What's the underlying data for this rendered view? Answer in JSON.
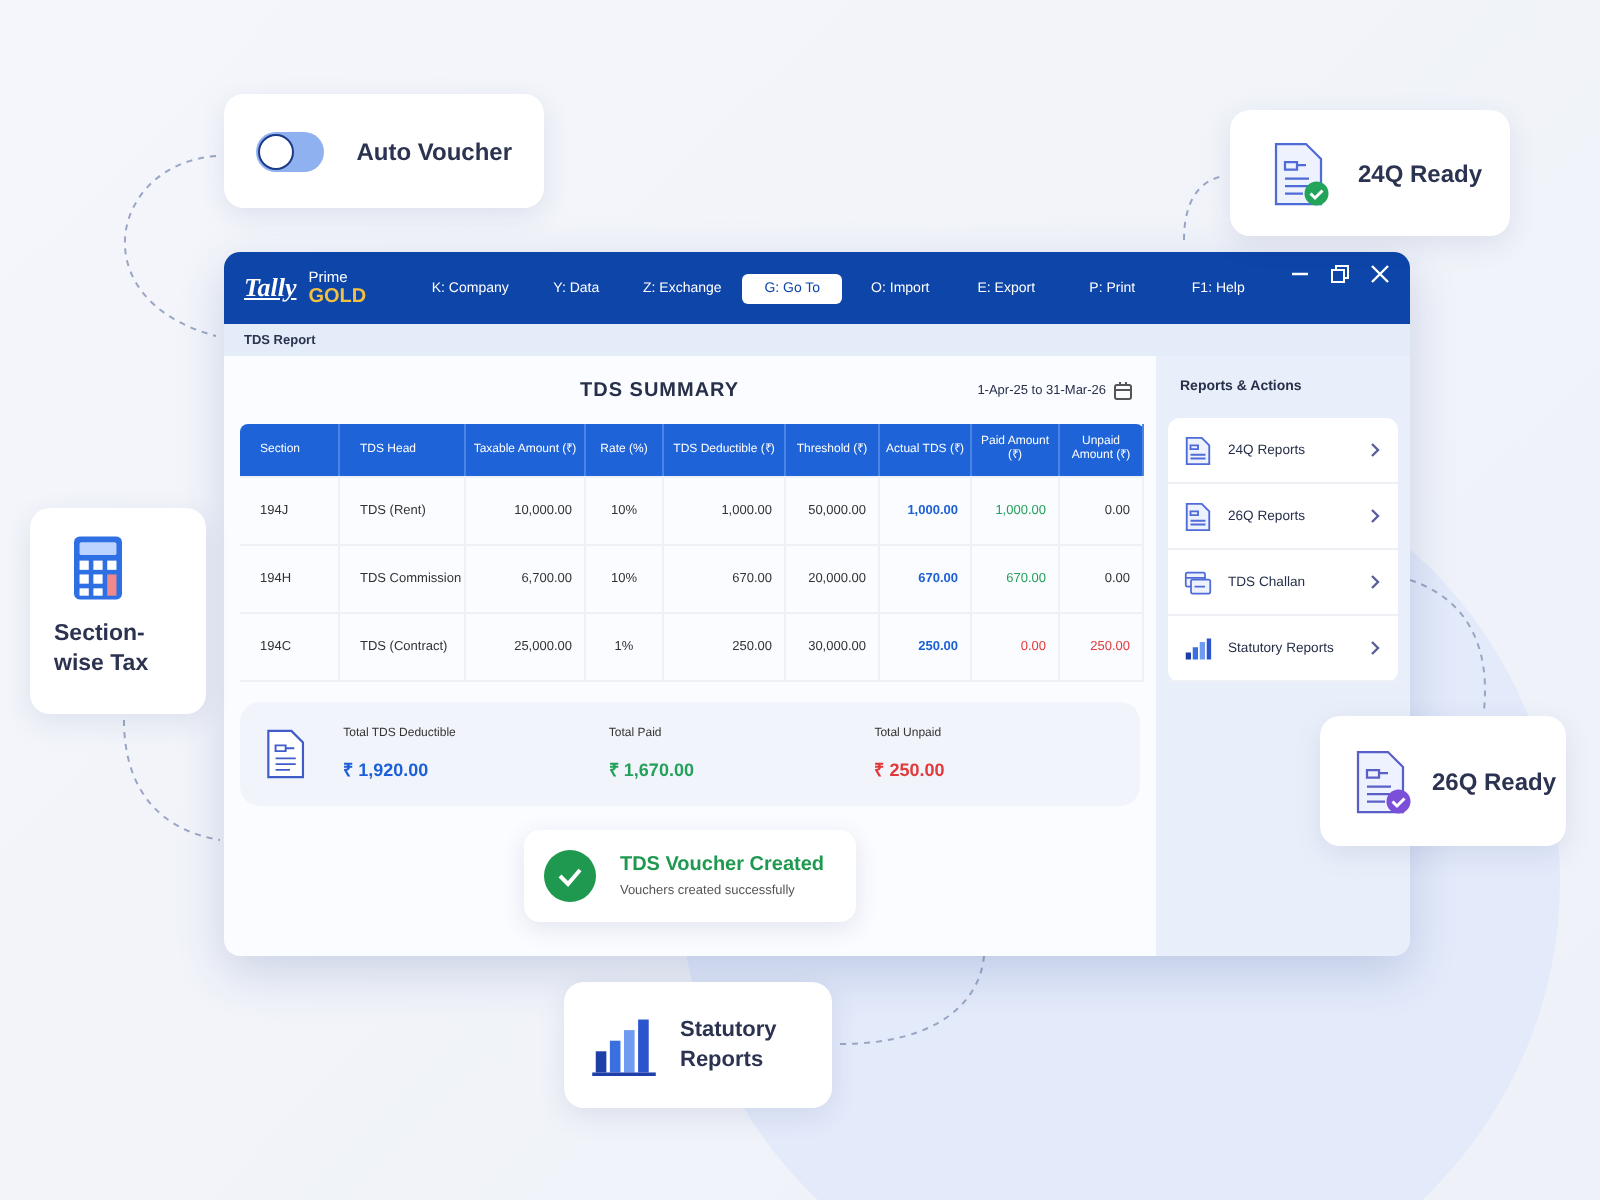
{
  "auto_voucher": {
    "label": "Auto Voucher",
    "on": false
  },
  "ready_24q": {
    "label": "24Q Ready"
  },
  "section_tax": {
    "label": "Section-wise Tax"
  },
  "ready_26q": {
    "label": "26Q Ready"
  },
  "statutory": {
    "label": "Statutory Reports"
  },
  "window": {
    "logo": "Tally",
    "product": "Prime",
    "edition": "GOLD",
    "menu": [
      {
        "label": "K: Company",
        "selected": false
      },
      {
        "label": "Y: Data",
        "selected": false
      },
      {
        "label": "Z: Exchange",
        "selected": false
      },
      {
        "label": "G: Go To",
        "selected": true
      },
      {
        "label": "O: Import",
        "selected": false
      },
      {
        "label": "E: Export",
        "selected": false
      },
      {
        "label": "P: Print",
        "selected": false
      },
      {
        "label": "F1: Help",
        "selected": false
      }
    ],
    "breadcrumb": "TDS Report"
  },
  "report": {
    "title": "TDS SUMMARY",
    "period": "1-Apr-25 to 31-Mar-26",
    "columns": [
      "Section",
      "TDS Head",
      "Taxable Amount (₹)",
      "Rate (%)",
      "TDS Deductible (₹)",
      "Threshold (₹)",
      "Actual TDS (₹)",
      "Paid Amount (₹)",
      "Unpaid Amount (₹)"
    ],
    "rows": [
      {
        "section": "194J",
        "head": "TDS (Rent)",
        "taxable": "10,000.00",
        "rate": "10%",
        "deductible": "1,000.00",
        "threshold": "50,000.00",
        "actual": "1,000.00",
        "paid": "1,000.00",
        "unpaid": "0.00",
        "paid_in_full": true
      },
      {
        "section": "194H",
        "head": "TDS Commission",
        "taxable": "6,700.00",
        "rate": "10%",
        "deductible": "670.00",
        "threshold": "20,000.00",
        "actual": "670.00",
        "paid": "670.00",
        "unpaid": "0.00",
        "paid_in_full": true
      },
      {
        "section": "194C",
        "head": "TDS (Contract)",
        "taxable": "25,000.00",
        "rate": "1%",
        "deductible": "250.00",
        "threshold": "30,000.00",
        "actual": "250.00",
        "paid": "0.00",
        "unpaid": "250.00",
        "paid_in_full": false
      }
    ],
    "totals": [
      {
        "label": "Total TDS Deductible",
        "value": "₹ 1,920.00",
        "kind": "deductible"
      },
      {
        "label": "Total Paid",
        "value": "₹ 1,670.00",
        "kind": "paid"
      },
      {
        "label": "Total Unpaid",
        "value": "₹ 250.00",
        "kind": "unpaid"
      }
    ],
    "toast": {
      "title": "TDS Voucher Created",
      "message": "Vouchers created successfully"
    }
  },
  "actions": {
    "title": "Reports & Actions",
    "items": [
      {
        "label": "24Q Reports",
        "kind": "document"
      },
      {
        "label": "26Q Reports",
        "kind": "document"
      },
      {
        "label": "TDS Challan",
        "kind": "challan"
      },
      {
        "label": "Statutory Reports",
        "kind": "chart"
      }
    ]
  }
}
